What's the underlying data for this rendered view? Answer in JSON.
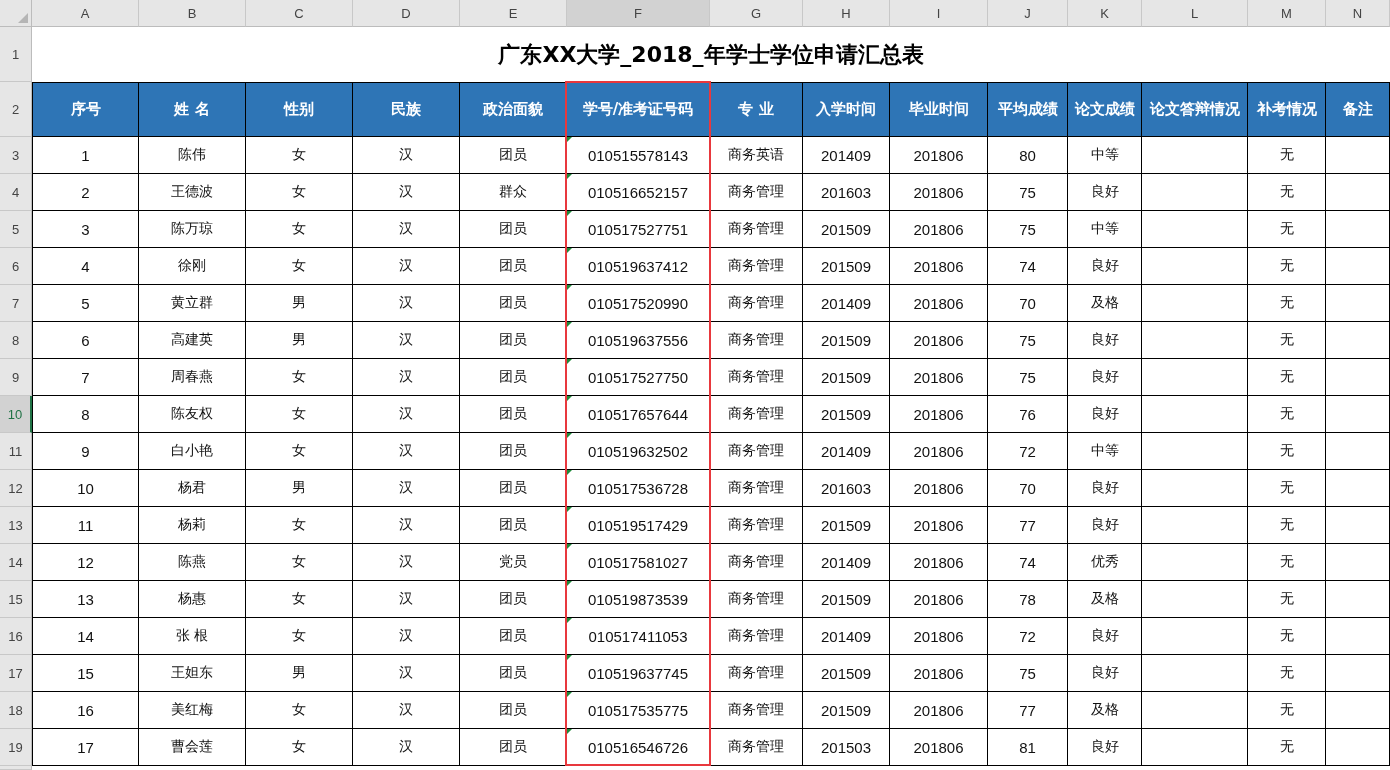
{
  "column_headers": [
    {
      "letter": "A",
      "highlighted": false
    },
    {
      "letter": "B",
      "highlighted": false
    },
    {
      "letter": "C",
      "highlighted": false
    },
    {
      "letter": "D",
      "highlighted": false
    },
    {
      "letter": "E",
      "highlighted": false
    },
    {
      "letter": "F",
      "highlighted": true
    },
    {
      "letter": "G",
      "highlighted": false
    },
    {
      "letter": "H",
      "highlighted": false
    },
    {
      "letter": "I",
      "highlighted": false
    },
    {
      "letter": "J",
      "highlighted": false
    },
    {
      "letter": "K",
      "highlighted": false
    },
    {
      "letter": "L",
      "highlighted": false
    },
    {
      "letter": "M",
      "highlighted": false
    },
    {
      "letter": "N",
      "highlighted": false
    }
  ],
  "row_headers": [
    {
      "label": "1",
      "selected": false
    },
    {
      "label": "2",
      "selected": false
    },
    {
      "label": "3",
      "selected": false
    },
    {
      "label": "4",
      "selected": false
    },
    {
      "label": "5",
      "selected": false
    },
    {
      "label": "6",
      "selected": false
    },
    {
      "label": "7",
      "selected": false
    },
    {
      "label": "8",
      "selected": false
    },
    {
      "label": "9",
      "selected": false
    },
    {
      "label": "10",
      "selected": true
    },
    {
      "label": "11",
      "selected": false
    },
    {
      "label": "12",
      "selected": false
    },
    {
      "label": "13",
      "selected": false
    },
    {
      "label": "14",
      "selected": false
    },
    {
      "label": "15",
      "selected": false
    },
    {
      "label": "16",
      "selected": false
    },
    {
      "label": "17",
      "selected": false
    },
    {
      "label": "18",
      "selected": false
    },
    {
      "label": "19",
      "selected": false
    }
  ],
  "title": "广东XX大学_2018_年学士学位申请汇总表",
  "table": {
    "columns": [
      "序号",
      "姓 名",
      "性别",
      "民族",
      "政治面貌",
      "学号/准考证号码",
      "专 业",
      "入学时间",
      "毕业时间",
      "平均成绩",
      "论文成绩",
      "论文答辩情况",
      "补考情况",
      "备注"
    ],
    "rows": [
      {
        "no": "1",
        "name": "陈伟",
        "gender": "女",
        "ethnicity": "汉",
        "political": "团员",
        "student_id": "010515578143",
        "id_flag": true,
        "major": "商务英语",
        "enrolled": "201409",
        "graduated": "201806",
        "avg_score": "80",
        "thesis_grade": "中等",
        "makeup": "无"
      },
      {
        "no": "2",
        "name": "王德波",
        "gender": "女",
        "ethnicity": "汉",
        "political": "群众",
        "student_id": "010516652157",
        "id_flag": true,
        "major": "商务管理",
        "enrolled": "201603",
        "graduated": "201806",
        "avg_score": "75",
        "thesis_grade": "良好",
        "makeup": "无"
      },
      {
        "no": "3",
        "name": "陈万琼",
        "gender": "女",
        "ethnicity": "汉",
        "political": "团员",
        "student_id": "010517527751",
        "id_flag": true,
        "major": "商务管理",
        "enrolled": "201509",
        "graduated": "201806",
        "avg_score": "75",
        "thesis_grade": "中等",
        "makeup": "无"
      },
      {
        "no": "4",
        "name": "徐刚",
        "gender": "女",
        "ethnicity": "汉",
        "political": "团员",
        "student_id": "010519637412",
        "id_flag": true,
        "major": "商务管理",
        "enrolled": "201509",
        "graduated": "201806",
        "avg_score": "74",
        "thesis_grade": "良好",
        "makeup": "无"
      },
      {
        "no": "5",
        "name": "黄立群",
        "gender": "男",
        "ethnicity": "汉",
        "political": "团员",
        "student_id": "010517520990",
        "id_flag": true,
        "major": "商务管理",
        "enrolled": "201409",
        "graduated": "201806",
        "avg_score": "70",
        "thesis_grade": "及格",
        "makeup": "无"
      },
      {
        "no": "6",
        "name": "高建英",
        "gender": "男",
        "ethnicity": "汉",
        "political": "团员",
        "student_id": "010519637556",
        "id_flag": true,
        "major": "商务管理",
        "enrolled": "201509",
        "graduated": "201806",
        "avg_score": "75",
        "thesis_grade": "良好",
        "makeup": "无"
      },
      {
        "no": "7",
        "name": "周春燕",
        "gender": "女",
        "ethnicity": "汉",
        "political": "团员",
        "student_id": "010517527750",
        "id_flag": true,
        "major": "商务管理",
        "enrolled": "201509",
        "graduated": "201806",
        "avg_score": "75",
        "thesis_grade": "良好",
        "makeup": "无"
      },
      {
        "no": "8",
        "name": "陈友权",
        "gender": "女",
        "ethnicity": "汉",
        "political": "团员",
        "student_id": "010517657644",
        "id_flag": true,
        "major": "商务管理",
        "enrolled": "201509",
        "graduated": "201806",
        "avg_score": "76",
        "thesis_grade": "良好",
        "makeup": "无"
      },
      {
        "no": "9",
        "name": "白小艳",
        "gender": "女",
        "ethnicity": "汉",
        "political": "团员",
        "student_id": "010519632502",
        "id_flag": true,
        "major": "商务管理",
        "enrolled": "201409",
        "graduated": "201806",
        "avg_score": "72",
        "thesis_grade": "中等",
        "makeup": "无"
      },
      {
        "no": "10",
        "name": "杨君",
        "gender": "男",
        "ethnicity": "汉",
        "political": "团员",
        "student_id": "010517536728",
        "id_flag": true,
        "major": "商务管理",
        "enrolled": "201603",
        "graduated": "201806",
        "avg_score": "70",
        "thesis_grade": "良好",
        "makeup": "无"
      },
      {
        "no": "11",
        "name": "杨莉",
        "gender": "女",
        "ethnicity": "汉",
        "political": "团员",
        "student_id": "010519517429",
        "id_flag": true,
        "major": "商务管理",
        "enrolled": "201509",
        "graduated": "201806",
        "avg_score": "77",
        "thesis_grade": "良好",
        "makeup": "无"
      },
      {
        "no": "12",
        "name": "陈燕",
        "gender": "女",
        "ethnicity": "汉",
        "political": "党员",
        "student_id": "010517581027",
        "id_flag": true,
        "major": "商务管理",
        "enrolled": "201409",
        "graduated": "201806",
        "avg_score": "74",
        "thesis_grade": "优秀",
        "makeup": "无"
      },
      {
        "no": "13",
        "name": "杨惠",
        "gender": "女",
        "ethnicity": "汉",
        "political": "团员",
        "student_id": "010519873539",
        "id_flag": true,
        "major": "商务管理",
        "enrolled": "201509",
        "graduated": "201806",
        "avg_score": "78",
        "thesis_grade": "及格",
        "makeup": "无"
      },
      {
        "no": "14",
        "name": "张 根",
        "gender": "女",
        "ethnicity": "汉",
        "political": "团员",
        "student_id": "010517411053",
        "id_flag": true,
        "major": "商务管理",
        "enrolled": "201409",
        "graduated": "201806",
        "avg_score": "72",
        "thesis_grade": "良好",
        "makeup": "无"
      },
      {
        "no": "15",
        "name": "王妲东",
        "gender": "男",
        "ethnicity": "汉",
        "political": "团员",
        "student_id": "010519637745",
        "id_flag": true,
        "major": "商务管理",
        "enrolled": "201509",
        "graduated": "201806",
        "avg_score": "75",
        "thesis_grade": "良好",
        "makeup": "无"
      },
      {
        "no": "16",
        "name": "美红梅",
        "gender": "女",
        "ethnicity": "汉",
        "political": "团员",
        "student_id": "010517535775",
        "id_flag": true,
        "major": "商务管理",
        "enrolled": "201509",
        "graduated": "201806",
        "avg_score": "77",
        "thesis_grade": "及格",
        "makeup": "无"
      },
      {
        "no": "17",
        "name": "曹会莲",
        "gender": "女",
        "ethnicity": "汉",
        "political": "团员",
        "student_id": "010516546726",
        "id_flag": true,
        "major": "商务管理",
        "enrolled": "201503",
        "graduated": "201806",
        "avg_score": "81",
        "thesis_grade": "良好",
        "makeup": "无"
      }
    ]
  }
}
